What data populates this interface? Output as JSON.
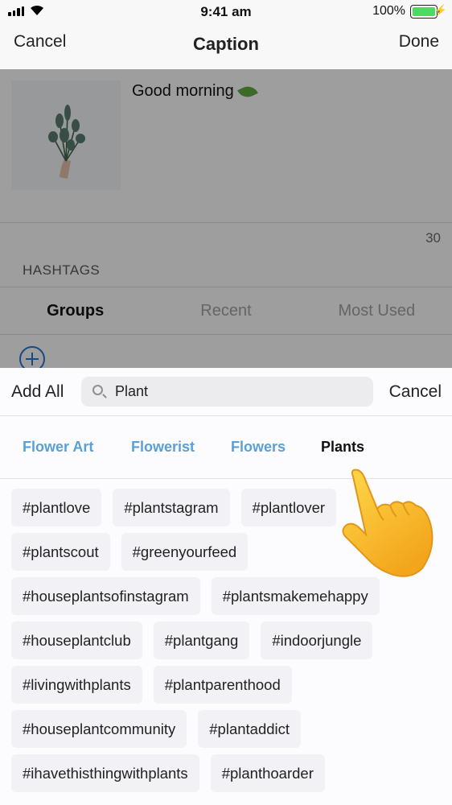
{
  "status_bar": {
    "time": "9:41 am",
    "battery": "100%"
  },
  "nav": {
    "cancel": "Cancel",
    "title": "Caption",
    "done": "Done"
  },
  "editor": {
    "caption": "Good morning",
    "char_count": "30",
    "hashtags_label": "HASHTAGS",
    "segments": [
      "Groups",
      "Recent",
      "Most Used"
    ],
    "active_segment": "Groups"
  },
  "sheet": {
    "add_all": "Add All",
    "search_value": "Plant",
    "cancel": "Cancel",
    "tabs": [
      "Flower Art",
      "Flowerist",
      "Flowers",
      "Plants"
    ],
    "active_tab": "Plants",
    "accent": "#5ba0d5",
    "hashtag_rows": [
      [
        "#plantlove",
        "#plantstagram",
        "#plantlover"
      ],
      [
        "#plantscout",
        "#greenyourfeed"
      ],
      [
        "#houseplantsofinstagram",
        "#plantsmakemehappy"
      ],
      [
        "#houseplantclub",
        "#plantgang",
        "#indoorjungle"
      ],
      [
        "#livingwithplants",
        "#plantparenthood"
      ],
      [
        "#houseplantcommunity",
        "#plantaddict"
      ],
      [
        "#ihavethisthingwithplants",
        "#planthoarder"
      ]
    ]
  }
}
